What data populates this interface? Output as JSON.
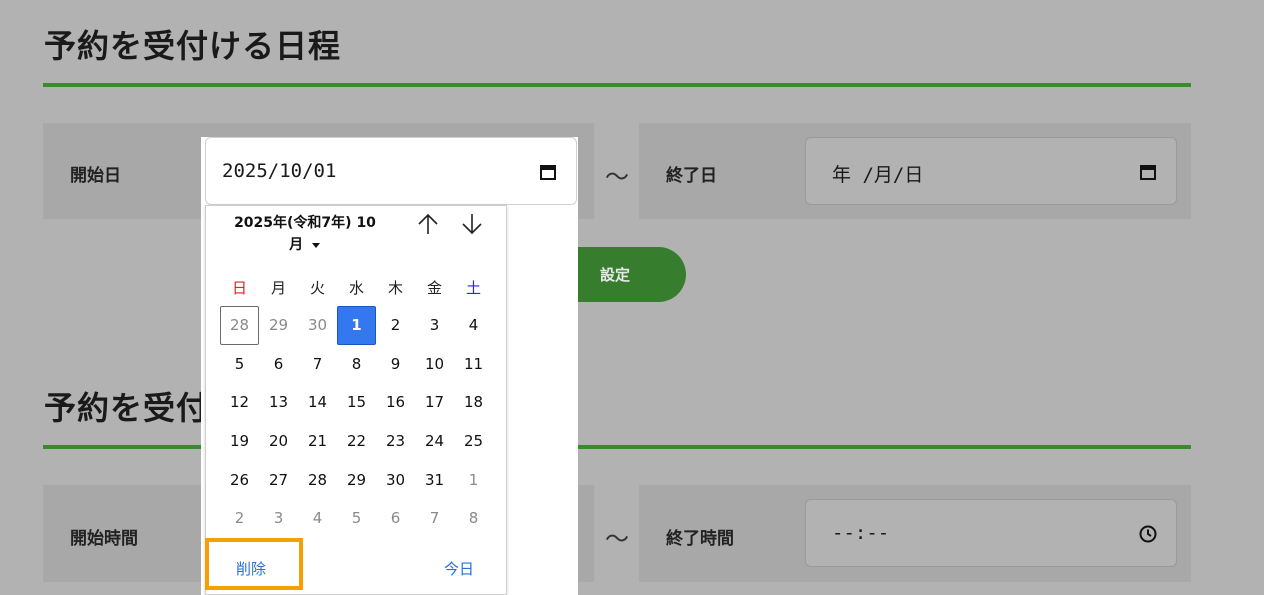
{
  "sections": {
    "dates_title": "予約を受付ける日程",
    "time_title": "予約を受付"
  },
  "date_row": {
    "start_label": "開始日",
    "start_value": "2025/10/01",
    "separator": "〜",
    "end_label": "終了日",
    "end_value": "年 /月/日"
  },
  "time_row": {
    "start_label": "開始時間",
    "separator": "〜",
    "end_label": "終了時間",
    "end_value": "--:--"
  },
  "set_button": "設定",
  "calendar": {
    "month_line1": "2025年(令和7年) 10",
    "month_line2": "月",
    "weekdays": [
      "日",
      "月",
      "火",
      "水",
      "木",
      "金",
      "土"
    ],
    "weeks": [
      [
        "28",
        "29",
        "30",
        "1",
        "2",
        "3",
        "4"
      ],
      [
        "5",
        "6",
        "7",
        "8",
        "9",
        "10",
        "11"
      ],
      [
        "12",
        "13",
        "14",
        "15",
        "16",
        "17",
        "18"
      ],
      [
        "19",
        "20",
        "21",
        "22",
        "23",
        "24",
        "25"
      ],
      [
        "26",
        "27",
        "28",
        "29",
        "30",
        "31",
        "1"
      ],
      [
        "2",
        "3",
        "4",
        "5",
        "6",
        "7",
        "8"
      ]
    ],
    "clear_label": "削除",
    "today_label": "今日"
  },
  "colors": {
    "accent_green": "#3b8a32",
    "selected_blue": "#3478f0",
    "sunday_red": "#e02020",
    "saturday_blue": "#2a2ad8",
    "highlight_orange": "#f5a000"
  },
  "icons": [
    "calendar-icon",
    "clock-icon",
    "arrow-up-icon",
    "arrow-down-icon",
    "caret-down-icon"
  ]
}
